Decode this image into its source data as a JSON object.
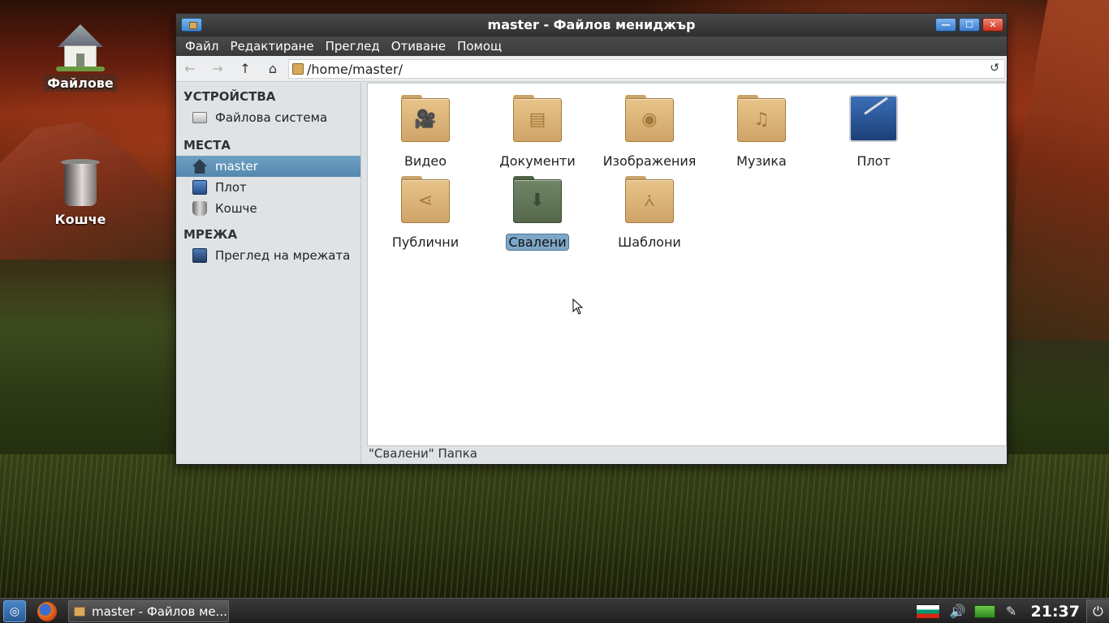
{
  "desktop": {
    "icons": [
      {
        "label": "Файлове",
        "icon": "home-folder-icon"
      },
      {
        "label": "Кошче",
        "icon": "trash-icon"
      }
    ]
  },
  "window": {
    "title": "master - Файлов мениджър",
    "buttons": {
      "minimize": "—",
      "maximize": "☐",
      "close": "✕"
    }
  },
  "menubar": {
    "items": [
      "Файл",
      "Редактиране",
      "Преглед",
      "Отиване",
      "Помощ"
    ]
  },
  "toolbar": {
    "back": "←",
    "forward": "→",
    "up": "↑",
    "home": "⌂",
    "path": "/home/master/",
    "reload": "↺"
  },
  "sidebar": {
    "sections": [
      {
        "heading": "УСТРОЙСТВА",
        "items": [
          {
            "label": "Файлова система",
            "icon": "drive-icon"
          }
        ]
      },
      {
        "heading": "МЕСТА",
        "items": [
          {
            "label": "master",
            "icon": "home-icon",
            "active": true
          },
          {
            "label": "Плот",
            "icon": "desktop-icon"
          },
          {
            "label": "Кошче",
            "icon": "trash-icon"
          }
        ]
      },
      {
        "heading": "МРЕЖА",
        "items": [
          {
            "label": "Преглед на мрежата",
            "icon": "network-icon"
          }
        ]
      }
    ]
  },
  "files": [
    {
      "name": "Видео",
      "icon": "video-folder-icon",
      "glyph": "🎥"
    },
    {
      "name": "Документи",
      "icon": "documents-folder-icon",
      "glyph": "▤"
    },
    {
      "name": "Изображения",
      "icon": "pictures-folder-icon",
      "glyph": "◉"
    },
    {
      "name": "Музика",
      "icon": "music-folder-icon",
      "glyph": "♫"
    },
    {
      "name": "Плот",
      "icon": "desktop-icon",
      "glyph": ""
    },
    {
      "name": "Публични",
      "icon": "public-folder-icon",
      "glyph": "⋖"
    },
    {
      "name": "Свалени",
      "icon": "downloads-folder-icon",
      "glyph": "⬇",
      "selected": true
    },
    {
      "name": "Шаблони",
      "icon": "templates-folder-icon",
      "glyph": "⩑"
    }
  ],
  "statusbar": {
    "text": "\"Свалени\" Папка"
  },
  "taskbar": {
    "task_label": "master - Файлов ме...",
    "clock": "21:37",
    "tray": {
      "volume": "🔊",
      "pen": "✎",
      "power": "⏻"
    }
  },
  "colors": {
    "selection": "#7ea7c7",
    "sidebar_active": "#5f93b8",
    "folder": "#dcb67a",
    "downloads_folder": "#5f7356"
  }
}
